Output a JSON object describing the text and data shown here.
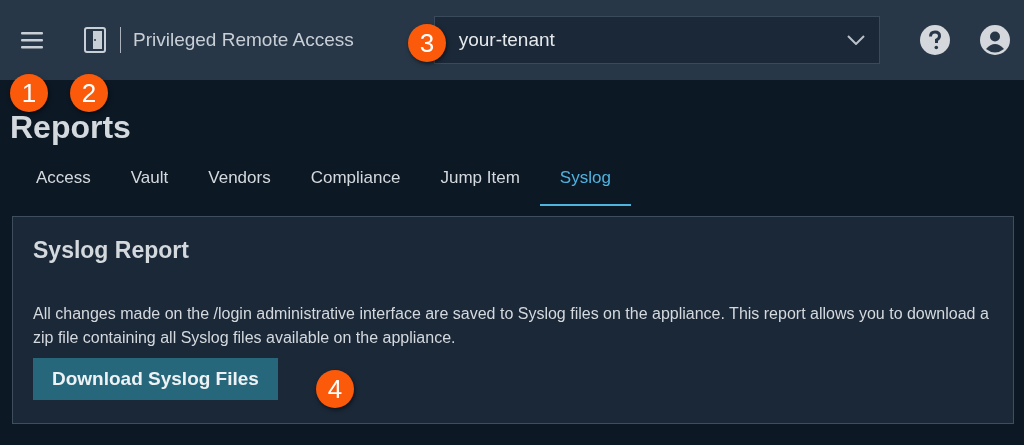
{
  "header": {
    "app_title": "Privileged Remote Access",
    "tenant_select": {
      "value": "your-tenant"
    }
  },
  "page_title": "Reports",
  "tabs": [
    {
      "label": "Access",
      "selected": false
    },
    {
      "label": "Vault",
      "selected": false
    },
    {
      "label": "Vendors",
      "selected": false
    },
    {
      "label": "Compliance",
      "selected": false
    },
    {
      "label": "Jump Item",
      "selected": false
    },
    {
      "label": "Syslog",
      "selected": true
    }
  ],
  "panel": {
    "title": "Syslog Report",
    "description": "All changes made on the /login administrative interface are saved to Syslog files on the appliance. This report allows you to download a zip file containing all Syslog files available on the appliance.",
    "button": "Download Syslog Files"
  },
  "callouts": [
    "1",
    "2",
    "3",
    "4"
  ]
}
